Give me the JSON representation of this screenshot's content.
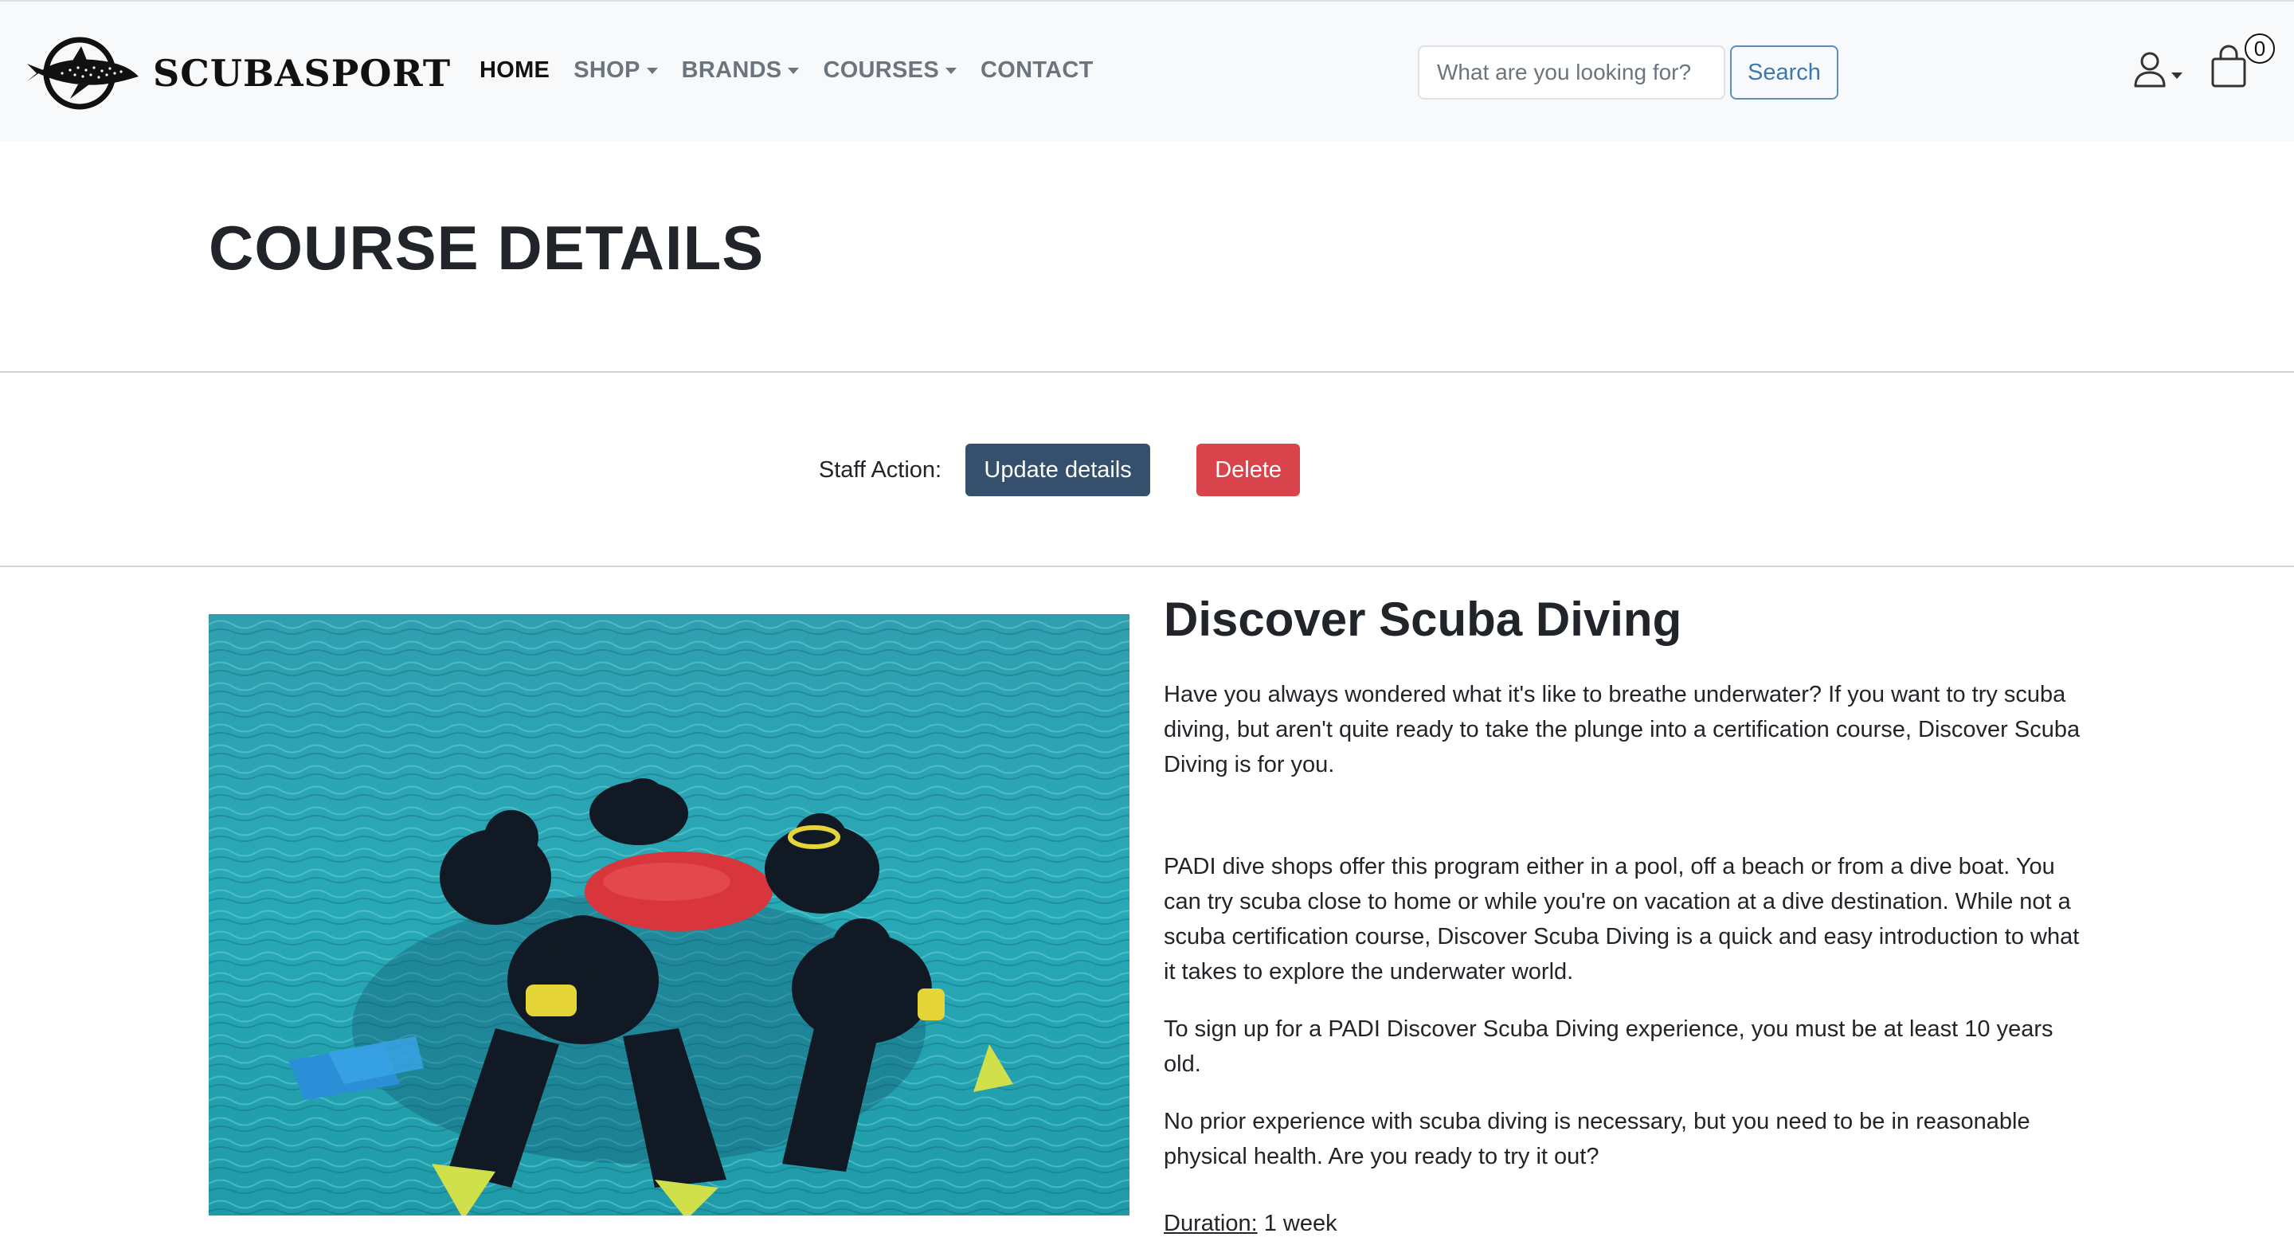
{
  "brand": {
    "name": "SCUBASPORT",
    "logo": "whale-shark-logo"
  },
  "nav": {
    "items": [
      {
        "label": "HOME",
        "active": true,
        "dropdown": false
      },
      {
        "label": "SHOP",
        "active": false,
        "dropdown": true
      },
      {
        "label": "BRANDS",
        "active": false,
        "dropdown": true
      },
      {
        "label": "COURSES",
        "active": false,
        "dropdown": true
      },
      {
        "label": "CONTACT",
        "active": false,
        "dropdown": false
      }
    ]
  },
  "search": {
    "placeholder": "What are you looking for?",
    "value": "",
    "button_label": "Search"
  },
  "user": {
    "icon": "user-icon"
  },
  "cart": {
    "icon": "shopping-bag-icon",
    "count": "0"
  },
  "page": {
    "title": "COURSE DETAILS"
  },
  "staff": {
    "label": "Staff Action:",
    "update_label": "Update details",
    "delete_label": "Delete"
  },
  "course": {
    "name": "Discover Scuba Diving",
    "paragraphs": [
      "Have you always wondered what it's like to breathe underwater? If you want to try scuba diving, but aren't quite ready to take the plunge into a certification course, Discover Scuba Diving is for you.",
      "PADI dive shops offer this program either in a pool, off a beach or from a dive boat. You can try scuba close to home or while you're on vacation at a dive destination. While not a scuba certification course, Discover Scuba Diving is a quick and easy introduction to what it takes to explore the underwater world.",
      "To sign up for a PADI Discover Scuba Diving experience, you must be at least 10 years old.",
      "No prior experience with scuba diving is necessary, but you need to be in reasonable physical health. Are you ready to try it out?"
    ],
    "duration_label": "Duration:",
    "duration_value": " 1 week",
    "image_subject": "divers-in-water-photo"
  },
  "colors": {
    "navbar_bg": "#f8f9fa",
    "update_button": "#34506c",
    "delete_button": "#d9444c",
    "search_button": "#3b79b5",
    "water": "#2aa5b3"
  }
}
